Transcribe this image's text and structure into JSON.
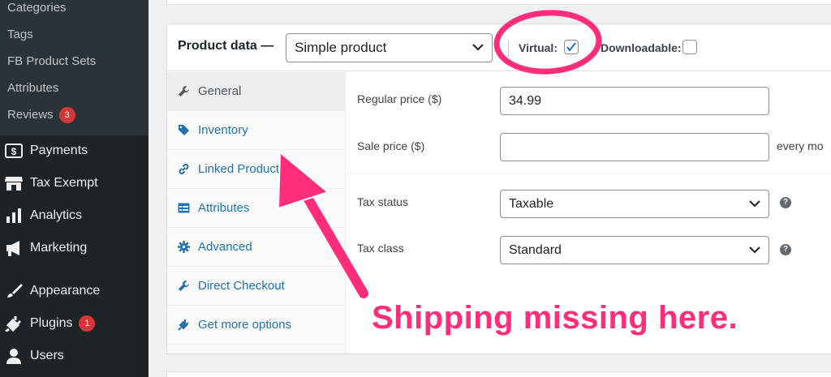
{
  "sidebar": {
    "submenu": [
      {
        "label": "Categories"
      },
      {
        "label": "Tags"
      },
      {
        "label": "FB Product Sets"
      },
      {
        "label": "Attributes"
      },
      {
        "label": "Reviews",
        "badge": "3"
      }
    ],
    "menu": [
      {
        "label": "Payments",
        "icon": "payments-icon"
      },
      {
        "label": "Tax Exempt",
        "icon": "store-icon"
      },
      {
        "label": "Analytics",
        "icon": "analytics-icon"
      },
      {
        "label": "Marketing",
        "icon": "megaphone-icon"
      },
      {
        "label": "Appearance",
        "icon": "paintbrush-icon"
      },
      {
        "label": "Plugins",
        "icon": "plugin-icon",
        "badge": "1"
      },
      {
        "label": "Users",
        "icon": "users-icon"
      }
    ]
  },
  "product_data": {
    "title": "Product data —",
    "type_select": "Simple product",
    "virtual_label": "Virtual:",
    "virtual_checked": true,
    "downloadable_label": "Downloadable:",
    "downloadable_checked": false
  },
  "tabs": [
    {
      "label": "General",
      "icon": "wrench-icon",
      "active": true
    },
    {
      "label": "Inventory",
      "icon": "tag-icon"
    },
    {
      "label": "Linked Products",
      "icon": "link-icon"
    },
    {
      "label": "Attributes",
      "icon": "list-icon"
    },
    {
      "label": "Advanced",
      "icon": "gear-icon"
    },
    {
      "label": "Direct Checkout",
      "icon": "wrench-icon"
    },
    {
      "label": "Get more options",
      "icon": "plug-icon"
    }
  ],
  "general": {
    "regular_price_label": "Regular price ($)",
    "regular_price_value": "34.99",
    "sale_price_label": "Sale price ($)",
    "sale_price_value": "",
    "sale_hint": "every mo",
    "tax_status_label": "Tax status",
    "tax_status_value": "Taxable",
    "tax_class_label": "Tax class",
    "tax_class_value": "Standard"
  },
  "annotation": {
    "text": "Shipping missing here.",
    "color": "#ff2d7a"
  },
  "colors": {
    "sidebar_bg": "#1d2327",
    "submenu_bg": "#2c3338",
    "link_blue": "#2271b1",
    "badge_red": "#d63638"
  }
}
